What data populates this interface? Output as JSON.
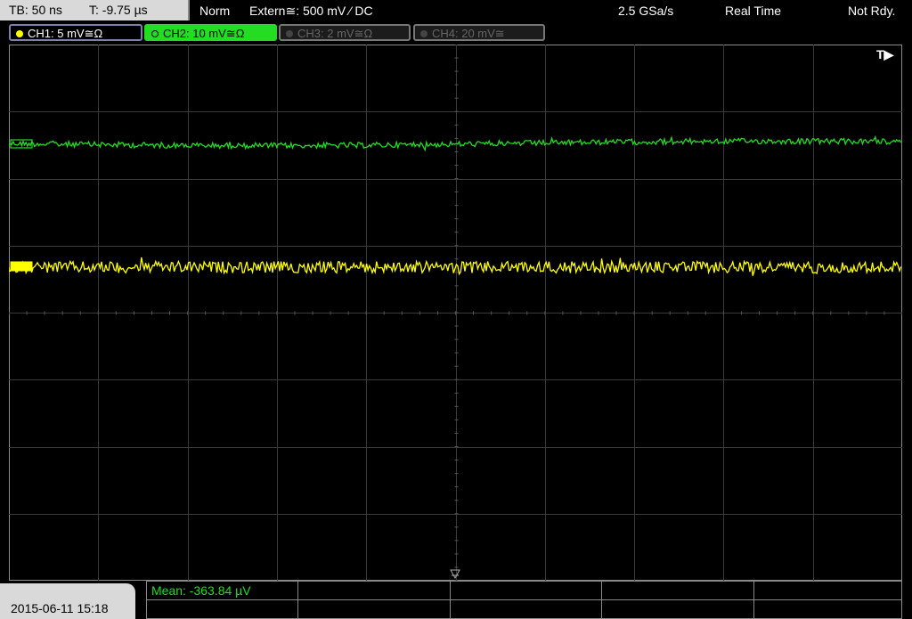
{
  "header": {
    "timebase": "TB: 50 ns",
    "trigger_time": "T: -9.75 µs",
    "trigger_mode": "Norm",
    "trigger_source": "Extern≅: 500 mV ⁄ DC",
    "sample_rate": "2.5 GSa/s",
    "acq_mode": "Real Time",
    "status": "Not Rdy."
  },
  "channels": [
    {
      "label": "CH1: 5 mV≅Ω",
      "color": "#ffff00",
      "active": true
    },
    {
      "label": "CH2: 10 mV≅Ω",
      "color": "#22dd22",
      "active": true,
      "selected": true
    },
    {
      "label": "CH3: 2 mV≅Ω",
      "color": "#666666",
      "active": false
    },
    {
      "label": "CH4: 20 mV≅",
      "color": "#666666",
      "active": false
    }
  ],
  "trigger_marker": "T▶",
  "footer": {
    "datetime": "2015-06-11 15:18",
    "measurement": "Mean: -363.84 µV"
  },
  "colors": {
    "ch1": "#ffff00",
    "ch2": "#22dd22",
    "grid": "#3a3a3a",
    "background": "#000000"
  }
}
